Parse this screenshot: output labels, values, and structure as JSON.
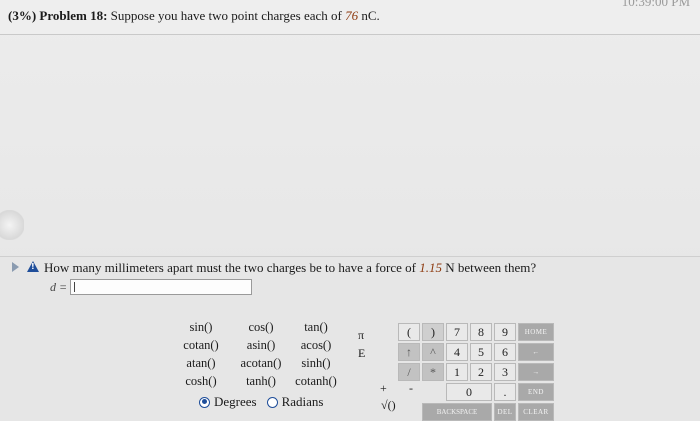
{
  "problem": {
    "weight": "(3%)",
    "number": "Problem 18:",
    "text_before": "Suppose you have two point charges each of",
    "charge_value": "76",
    "charge_unit": "nC."
  },
  "header": {
    "timestamp_fragment": "10:39:00 PM"
  },
  "question": {
    "text_before": "How many millimeters apart must the two charges be to have a force of",
    "force_value": "1.15",
    "text_after": "N between them?",
    "answer_label": "d =",
    "answer_value": ""
  },
  "functions": [
    "sin()",
    "cos()",
    "tan()",
    "cotan()",
    "asin()",
    "acos()",
    "atan()",
    "acotan()",
    "sinh()",
    "cosh()",
    "tanh()",
    "cotanh()"
  ],
  "angle_mode": {
    "options": [
      "Degrees",
      "Radians"
    ],
    "selected": "Degrees"
  },
  "symbols": {
    "pi": "π",
    "e": "E",
    "plus": "+",
    "minus": "-",
    "sqrt": "√()"
  },
  "keypad": {
    "row1": [
      "(",
      ")",
      "7",
      "8",
      "9",
      "HOME"
    ],
    "row2": [
      "↑",
      "^",
      "4",
      "5",
      "6",
      "←"
    ],
    "row3": [
      "/",
      "*",
      "1",
      "2",
      "3",
      "→"
    ],
    "row4": [
      "0",
      ".",
      "END"
    ],
    "row5": [
      "BACKSPACE",
      "DEL",
      "CLEAR"
    ]
  }
}
